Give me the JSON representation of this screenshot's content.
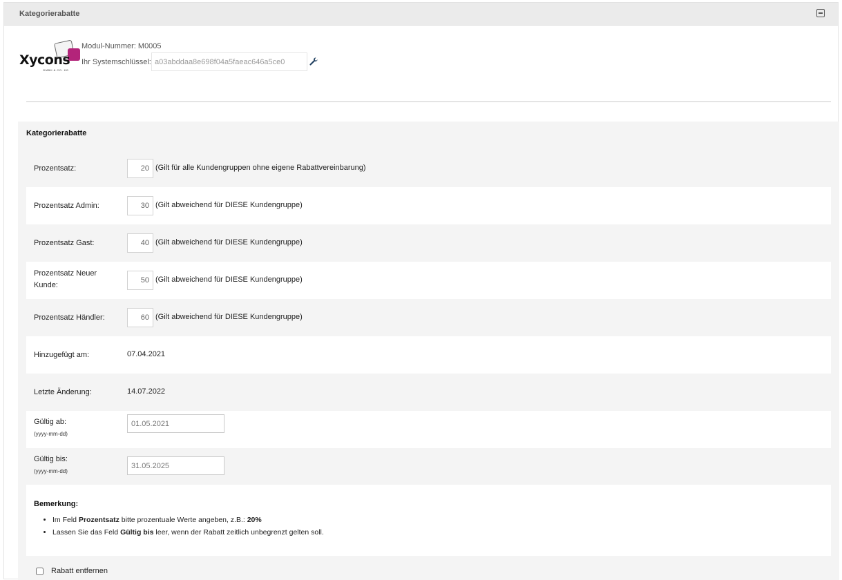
{
  "panel": {
    "title": "Kategorierabatte"
  },
  "module": {
    "logo_text": "Xycons",
    "logo_sub": "GMBH & CO. KG",
    "module_number": "Modul-Nummer: M0005",
    "system_key_label": "Ihr Systemschlüssel:",
    "system_key_value": "a03abddaa8e698f04a5faeac646a5ce0"
  },
  "section": {
    "title": "Kategorierabatte",
    "rows": [
      {
        "label": "Prozentsatz:",
        "value": "20",
        "hint": "(Gilt für alle Kundengruppen ohne eigene Rabattvereinbarung)"
      },
      {
        "label": "Prozentsatz Admin:",
        "value": "30",
        "hint": "(Gilt abweichend für DIESE Kundengruppe)"
      },
      {
        "label": "Prozentsatz Gast:",
        "value": "40",
        "hint": "(Gilt abweichend für DIESE Kundengruppe)"
      },
      {
        "label_line1": "Prozentsatz Neuer",
        "label_line2": "Kunde:",
        "value": "50",
        "hint": "(Gilt abweichend für DIESE Kundengruppe)"
      },
      {
        "label": "Prozentsatz Händler:",
        "value": "60",
        "hint": "(Gilt abweichend für DIESE Kundengruppe)"
      }
    ],
    "added": {
      "label": "Hinzugefügt am:",
      "value": "07.04.2021"
    },
    "changed": {
      "label": "Letzte Änderung:",
      "value": "14.07.2022"
    },
    "valid_from": {
      "label": "Gültig ab:",
      "format": "(yyyy-mm-dd)",
      "value": "01.05.2021"
    },
    "valid_to": {
      "label": "Gültig bis:",
      "format": "(yyyy-mm-dd)",
      "value": "31.05.2025"
    }
  },
  "remark": {
    "title": "Bemerkung:",
    "item1": {
      "pre": "Im Feld ",
      "bold": "Prozentsatz",
      "mid": " bitte prozentuale Werte angeben, z.B.: ",
      "bold2": "20%"
    },
    "item2": {
      "pre": "Lassen Sie das Feld ",
      "bold": "Gültig bis",
      "post": " leer, wenn der Rabatt zeitlich unbegrenzt gelten soll."
    }
  },
  "remove": {
    "label": "Rabatt entfernen"
  }
}
